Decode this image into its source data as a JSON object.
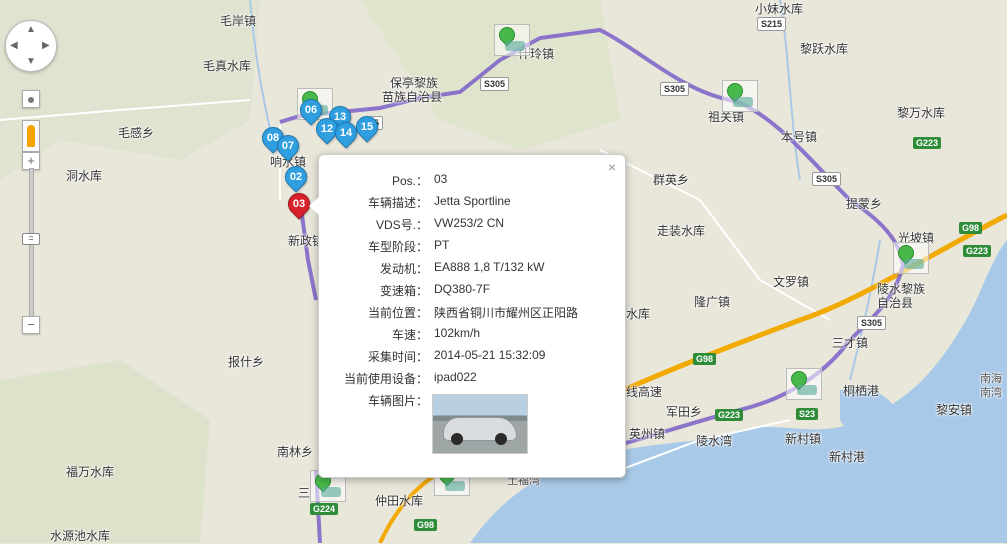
{
  "places": [
    {
      "name": "毛岸镇"
    },
    {
      "name": "毛真水库"
    },
    {
      "name": "毛感乡"
    },
    {
      "name": "响水镇"
    },
    {
      "name": "洞水库"
    },
    {
      "name": "新政镇"
    },
    {
      "name": "报什乡"
    },
    {
      "name": "南林乡"
    },
    {
      "name": "福万水库"
    },
    {
      "name": "水源池水库"
    },
    {
      "name": "保亭黎族"
    },
    {
      "name": "苗族自治县"
    },
    {
      "name": "什玲镇"
    },
    {
      "name": "小妹水库"
    },
    {
      "name": "黎跃水库"
    },
    {
      "name": "黎万水库"
    },
    {
      "name": "祖关镇"
    },
    {
      "name": "本号镇"
    },
    {
      "name": "群英乡"
    },
    {
      "name": "走装水库"
    },
    {
      "name": "提蒙乡"
    },
    {
      "name": "光坡镇"
    },
    {
      "name": "陵水黎族"
    },
    {
      "name": "自治县"
    },
    {
      "name": "文罗镇"
    },
    {
      "name": "隆广镇"
    },
    {
      "name": "水库"
    },
    {
      "name": "三才镇"
    },
    {
      "name": "桐栖港"
    },
    {
      "name": "黎安镇"
    },
    {
      "name": "军田乡"
    },
    {
      "name": "英州镇"
    },
    {
      "name": "陵水湾"
    },
    {
      "name": "新村镇"
    },
    {
      "name": "新村港"
    },
    {
      "name": "仲田水库"
    },
    {
      "name": "土福湾"
    },
    {
      "name": "南海"
    },
    {
      "name": "线高速"
    },
    {
      "name": "三"
    },
    {
      "name": "南湾"
    }
  ],
  "road_shields": [
    {
      "label": "S215",
      "type": "prov"
    },
    {
      "label": "S305",
      "type": "prov"
    },
    {
      "label": "S305",
      "type": "prov"
    },
    {
      "label": "S305",
      "type": "prov"
    },
    {
      "label": "S305",
      "type": "prov"
    },
    {
      "label": "G223",
      "type": "nat"
    },
    {
      "label": "G98",
      "type": "nat"
    },
    {
      "label": "G223",
      "type": "nat"
    },
    {
      "label": "G98",
      "type": "nat"
    },
    {
      "label": "G223",
      "type": "nat"
    },
    {
      "label": "S23",
      "type": "nat"
    },
    {
      "label": "G224",
      "type": "nat"
    },
    {
      "label": "G98",
      "type": "nat"
    },
    {
      "label": "5",
      "type": "prov"
    }
  ],
  "markers": [
    {
      "label": "06"
    },
    {
      "label": "13"
    },
    {
      "label": "12"
    },
    {
      "label": "14"
    },
    {
      "label": "15"
    },
    {
      "label": "08"
    },
    {
      "label": "07"
    },
    {
      "label": "02"
    },
    {
      "label": "03",
      "selected": true
    }
  ],
  "controls": {
    "zoom_in": "+",
    "zoom_out": "−",
    "pan_up": "▲",
    "pan_down": "▼",
    "pan_left": "◀",
    "pan_right": "▶"
  },
  "popup": {
    "close": "×",
    "fields": [
      {
        "key": "Pos.：",
        "value": "03"
      },
      {
        "key": "车辆描述：",
        "value": "Jetta Sportline"
      },
      {
        "key": "VDS号.：",
        "value": "VW253/2 CN"
      },
      {
        "key": "车型阶段：",
        "value": "PT"
      },
      {
        "key": "发动机：",
        "value": "EA888 1,8 T/132 kW"
      },
      {
        "key": "变速箱：",
        "value": "DQ380-7F"
      },
      {
        "key": "当前位置：",
        "value": "陕西省铜川市耀州区正阳路"
      },
      {
        "key": "车速：",
        "value": "102km/h"
      },
      {
        "key": "采集时间：",
        "value": "2014-05-21 15:32:09"
      },
      {
        "key": "当前使用设备：",
        "value": "ipad022"
      },
      {
        "key": "车辆图片：",
        "value": ""
      }
    ]
  },
  "colors": {
    "route": "#7b5fc8",
    "highway": "#f2a900",
    "water": "#a9c9e8",
    "land": "#e9e6da",
    "green": "#c9dbb0"
  }
}
